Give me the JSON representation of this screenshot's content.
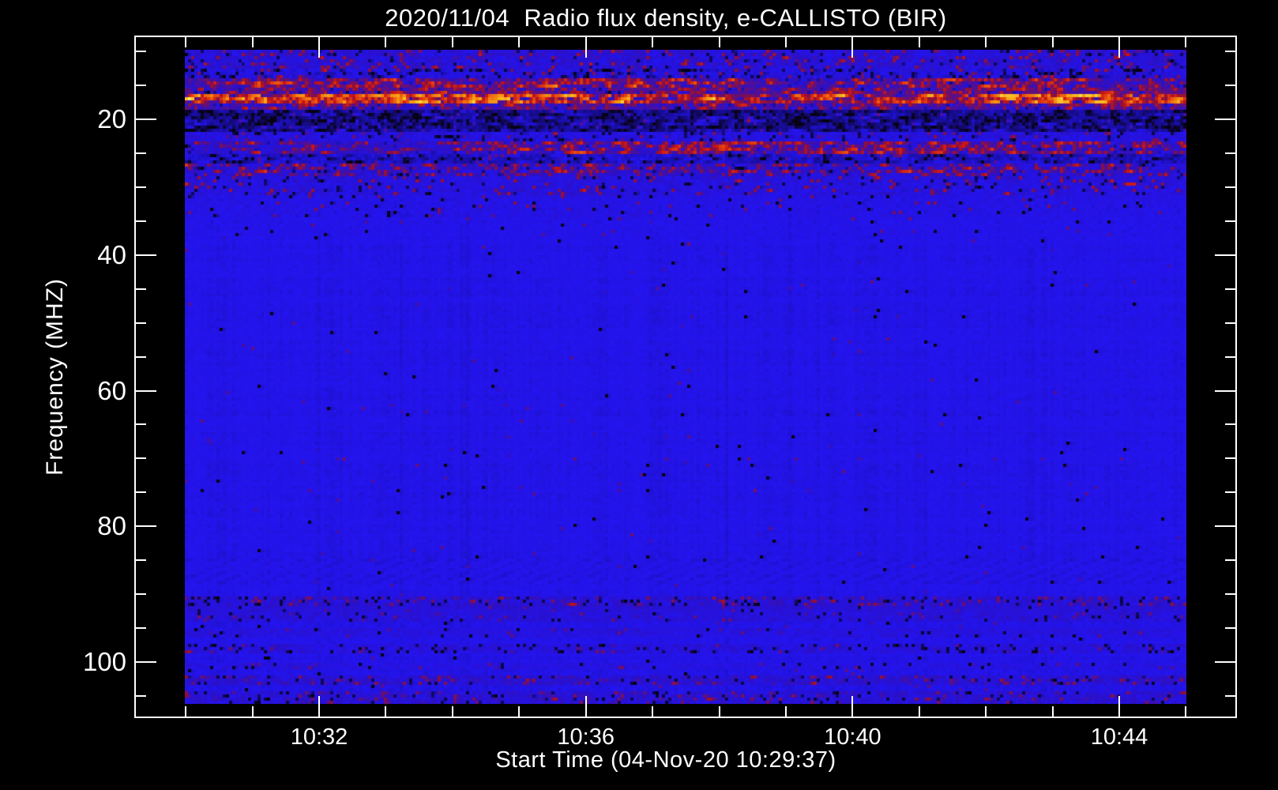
{
  "title": "2020/11/04  Radio flux density, e-CALLISTO (BIR)",
  "axes": {
    "x": {
      "label": "Start Time (04-Nov-20 10:29:37)",
      "major_ticks": [
        {
          "minute": 32,
          "label": "10:32"
        },
        {
          "minute": 36,
          "label": "10:36"
        },
        {
          "minute": 40,
          "label": "10:40"
        },
        {
          "minute": 44,
          "label": "10:44"
        }
      ],
      "minor_tick_minutes": [
        30,
        31,
        33,
        34,
        35,
        37,
        38,
        39,
        41,
        42,
        43,
        45
      ]
    },
    "y": {
      "label": "Frequency (MHZ)",
      "major_ticks": [
        {
          "mhz": 20,
          "label": "20"
        },
        {
          "mhz": 40,
          "label": "40"
        },
        {
          "mhz": 60,
          "label": "60"
        },
        {
          "mhz": 80,
          "label": "80"
        },
        {
          "mhz": 100,
          "label": "100"
        }
      ],
      "minor_tick_mhz": [
        10,
        15,
        25,
        30,
        35,
        45,
        50,
        55,
        65,
        70,
        75,
        85,
        90,
        95,
        105
      ]
    }
  },
  "chart_data": {
    "type": "heatmap",
    "title": "2020/11/04  Radio flux density, e-CALLISTO (BIR)",
    "xlabel": "Start Time (04-Nov-20 10:29:37)",
    "ylabel": "Frequency (MHZ)",
    "date": "2020/11/04",
    "observatory": "e-CALLISTO (BIR)",
    "start_time": "10:29:37",
    "x_data_range": [
      "10:30",
      "10:45"
    ],
    "x_tick_labels": [
      "10:32",
      "10:36",
      "10:40",
      "10:44"
    ],
    "y_range_mhz": [
      9.75,
      106.1
    ],
    "y_tick_mhz": [
      20,
      40,
      60,
      80,
      100
    ],
    "legend": "none",
    "grid": false,
    "colormap_stops": [
      [
        0.0,
        "#000000"
      ],
      [
        0.14,
        "#08031c"
      ],
      [
        0.26,
        "#1a0ea8"
      ],
      [
        0.34,
        "#2414ee"
      ],
      [
        0.44,
        "#2a10c8"
      ],
      [
        0.52,
        "#5c0f86"
      ],
      [
        0.6,
        "#8f0f3a"
      ],
      [
        0.68,
        "#c81616"
      ],
      [
        0.78,
        "#e84a10"
      ],
      [
        0.86,
        "#f89b12"
      ],
      [
        0.92,
        "#fde843"
      ],
      [
        1.0,
        "#ffffff"
      ]
    ],
    "background_band": {
      "mean": 0.335,
      "sd": 0.018,
      "hot": 0.004,
      "hotMean": 0.52,
      "black": 0.003,
      "persist": 0.12
    },
    "bands": [
      {
        "f0": 9.7,
        "f1": 12.3,
        "mean": 0.4,
        "sd": 0.13,
        "hot": 0.07,
        "hotMean": 0.7,
        "black": 0.06,
        "persist": 0.35
      },
      {
        "f0": 12.3,
        "f1": 13.9,
        "mean": 0.36,
        "sd": 0.15,
        "hot": 0.05,
        "hotMean": 0.7,
        "black": 0.16,
        "persist": 0.35
      },
      {
        "f0": 13.9,
        "f1": 15.1,
        "mean": 0.46,
        "sd": 0.14,
        "hot": 0.3,
        "hotMean": 0.8,
        "black": 0.06,
        "persist": 0.5,
        "segments": [
          [
            0.0,
            0.06,
            0.1
          ],
          [
            0.56,
            0.66,
            0.1
          ],
          [
            0.9,
            0.97,
            0.12
          ]
        ]
      },
      {
        "f0": 15.1,
        "f1": 16.2,
        "mean": 0.5,
        "sd": 0.12,
        "hot": 0.18,
        "hotMean": 0.72,
        "black": 0.08,
        "persist": 0.4
      },
      {
        "f0": 16.2,
        "f1": 17.6,
        "mean": 0.52,
        "sd": 0.14,
        "hot": 0.42,
        "hotMean": 0.88,
        "black": 0.05,
        "persist": 0.55,
        "segments": [
          [
            0.03,
            0.45,
            0.62
          ],
          [
            0.45,
            0.8,
            0.3
          ],
          [
            0.8,
            0.93,
            0.58
          ]
        ]
      },
      {
        "f0": 17.6,
        "f1": 18.6,
        "mean": 0.47,
        "sd": 0.15,
        "hot": 0.16,
        "hotMean": 0.73,
        "black": 0.1,
        "persist": 0.45
      },
      {
        "f0": 18.6,
        "f1": 21.6,
        "mean": 0.26,
        "sd": 0.12,
        "hot": 0.04,
        "hotMean": 0.66,
        "black": 0.24,
        "persist": 0.45
      },
      {
        "f0": 21.6,
        "f1": 23.2,
        "mean": 0.37,
        "sd": 0.1,
        "hot": 0.05,
        "hotMean": 0.62,
        "black": 0.08,
        "persist": 0.35
      },
      {
        "f0": 23.2,
        "f1": 24.8,
        "mean": 0.44,
        "sd": 0.12,
        "hot": 0.25,
        "hotMean": 0.76,
        "black": 0.06,
        "persist": 0.5,
        "segments": [
          [
            0.0,
            0.25,
            0.1
          ],
          [
            0.35,
            0.78,
            0.36
          ]
        ]
      },
      {
        "f0": 24.8,
        "f1": 26.4,
        "mean": 0.3,
        "sd": 0.1,
        "hot": 0.03,
        "hotMean": 0.62,
        "black": 0.1,
        "persist": 0.35
      },
      {
        "f0": 26.4,
        "f1": 28.4,
        "mean": 0.41,
        "sd": 0.12,
        "hot": 0.2,
        "hotMean": 0.72,
        "black": 0.06,
        "persist": 0.45
      },
      {
        "f0": 28.4,
        "f1": 31.0,
        "mean": 0.38,
        "sd": 0.1,
        "hot": 0.06,
        "hotMean": 0.7,
        "black": 0.05,
        "persist": 0.35
      },
      {
        "f0": 31.0,
        "f1": 34.5,
        "mean": 0.36,
        "sd": 0.06,
        "hot": 0.02,
        "hotMean": 0.62,
        "black": 0.02,
        "persist": 0.25
      },
      {
        "f0": 34.5,
        "f1": 37.0,
        "mean": 0.345,
        "sd": 0.035,
        "hot": 0.012,
        "hotMean": 0.56,
        "black": 0.01,
        "persist": 0.2
      },
      {
        "f0": 85.0,
        "f1": 88.5,
        "mean": 0.335,
        "sd": 0.02,
        "hot": 0.003,
        "hotMean": 0.5,
        "black": 0.004,
        "persist": 0.15,
        "herring": true
      },
      {
        "f0": 90.5,
        "f1": 91.7,
        "mean": 0.41,
        "sd": 0.11,
        "hot": 0.09,
        "hotMean": 0.62,
        "black": 0.12,
        "persist": 0.3
      },
      {
        "f0": 91.7,
        "f1": 92.9,
        "mean": 0.4,
        "sd": 0.05,
        "hot": 0.02,
        "hotMean": 0.55,
        "black": 0.02,
        "persist": 0.3
      },
      {
        "f0": 92.9,
        "f1": 94.2,
        "mean": 0.39,
        "sd": 0.08,
        "hot": 0.04,
        "hotMean": 0.58,
        "black": 0.06,
        "persist": 0.3
      },
      {
        "f0": 95.2,
        "f1": 96.3,
        "mean": 0.375,
        "sd": 0.06,
        "hot": 0.02,
        "hotMean": 0.55,
        "black": 0.03,
        "persist": 0.25
      },
      {
        "f0": 97.4,
        "f1": 98.7,
        "mean": 0.385,
        "sd": 0.09,
        "hot": 0.03,
        "hotMean": 0.58,
        "black": 0.1,
        "persist": 0.3
      },
      {
        "f0": 100.1,
        "f1": 101.2,
        "mean": 0.37,
        "sd": 0.06,
        "hot": 0.025,
        "hotMean": 0.56,
        "black": 0.04,
        "persist": 0.25
      },
      {
        "f0": 102.3,
        "f1": 103.4,
        "mean": 0.41,
        "sd": 0.11,
        "hot": 0.08,
        "hotMean": 0.62,
        "black": 0.08,
        "persist": 0.3
      },
      {
        "f0": 104.5,
        "f1": 106.2,
        "mean": 0.41,
        "sd": 0.11,
        "hot": 0.07,
        "hotMean": 0.62,
        "black": 0.08,
        "persist": 0.3
      }
    ]
  },
  "colors": {
    "background": "#000000",
    "foreground": "#ffffff",
    "spectrogram_base_blue": "#2414ee"
  }
}
